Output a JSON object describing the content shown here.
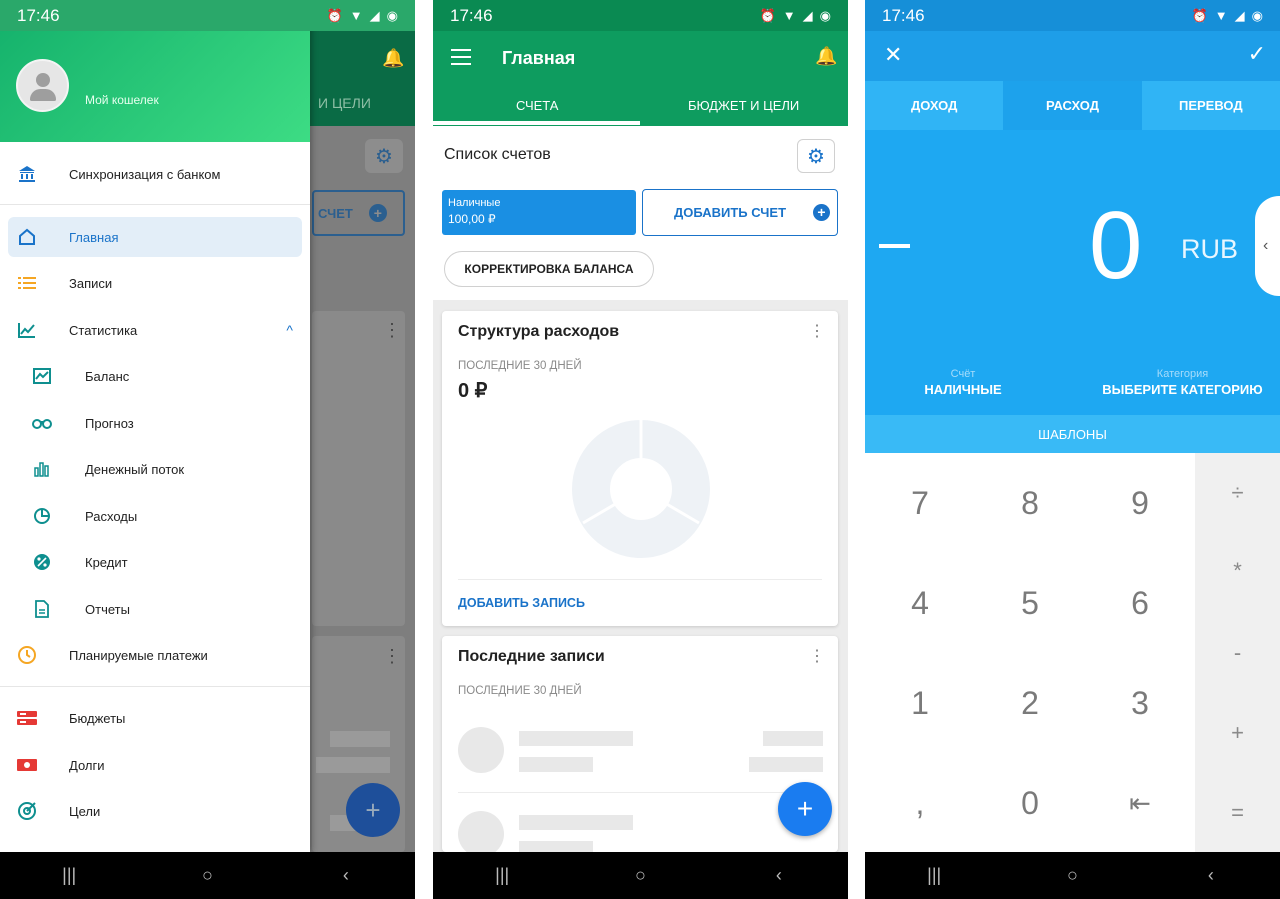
{
  "status": {
    "time": "17:46",
    "icons": [
      "alarm-icon",
      "wifi-icon",
      "signal-icon",
      "battery-icon"
    ]
  },
  "nav": {
    "recents": "|||",
    "home": "○",
    "back": "‹"
  },
  "screen1": {
    "wallet": "Мой кошелек",
    "bg_tab": "И ЦЕЛИ",
    "bg_add": "СЧЕТ",
    "sync": "Синхронизация с банком",
    "items": [
      {
        "label": "Главная",
        "icon": "home-icon"
      },
      {
        "label": "Записи",
        "icon": "list-icon"
      },
      {
        "label": "Статистика",
        "icon": "chart-line-icon"
      }
    ],
    "subitems": [
      {
        "label": "Баланс",
        "icon": "balance-icon"
      },
      {
        "label": "Прогноз",
        "icon": "binoculars-icon"
      },
      {
        "label": "Денежный поток",
        "icon": "bar-chart-icon"
      },
      {
        "label": "Расходы",
        "icon": "pie-chart-icon"
      },
      {
        "label": "Кредит",
        "icon": "percent-icon"
      },
      {
        "label": "Отчеты",
        "icon": "document-icon"
      }
    ],
    "planned": "Планируемые платежи",
    "bottom_items": [
      {
        "label": "Бюджеты",
        "icon": "budget-icon"
      },
      {
        "label": "Долги",
        "icon": "debt-icon"
      },
      {
        "label": "Цели",
        "icon": "target-icon"
      }
    ],
    "colors": {
      "drawer_header_from": "#13b06b",
      "drawer_header_to": "#3ddc84",
      "active": "#1a73c9"
    }
  },
  "screen2": {
    "title": "Главная",
    "tabs": [
      "СЧЕТА",
      "БЮДЖЕТ И ЦЕЛИ"
    ],
    "accounts_title": "Список счетов",
    "cash_label": "Наличные",
    "cash_value": "100,00 ₽",
    "add_account": "ДОБАВИТЬ СЧЕТ",
    "correction": "КОРРЕКТИРОВКА БАЛАНСА",
    "expenses_title": "Структура расходов",
    "period": "ПОСЛЕДНИЕ 30 ДНЕЙ",
    "expenses_amount": "0 ₽",
    "add_record": "ДОБАВИТЬ ЗАПИСЬ",
    "recent_title": "Последние записи",
    "recent_period": "ПОСЛЕДНИЕ 30 ДНЕЙ",
    "fab": "+",
    "colors": {
      "header": "#0e9c5f",
      "accent": "#1a73c9",
      "fab": "#1a7cf0"
    }
  },
  "screen3": {
    "tabs": [
      "ДОХОД",
      "РАСХОД",
      "ПЕРЕВОД"
    ],
    "active_tab": "РАСХОД",
    "amount": "0",
    "currency": "RUB",
    "account_label": "Счёт",
    "account_value": "НАЛИЧНЫЕ",
    "category_label": "Категория",
    "category_value": "ВЫБЕРИТЕ КАТЕГОРИЮ",
    "templates": "ШАБЛОНЫ",
    "keys": [
      "7",
      "8",
      "9",
      "4",
      "5",
      "6",
      "1",
      "2",
      "3",
      ",",
      "0",
      "⇤"
    ],
    "ops": [
      "÷",
      "*",
      "-",
      "+",
      "="
    ],
    "colors": {
      "top": "#1ea8f2",
      "toolbar": "#1e9ee8"
    }
  }
}
